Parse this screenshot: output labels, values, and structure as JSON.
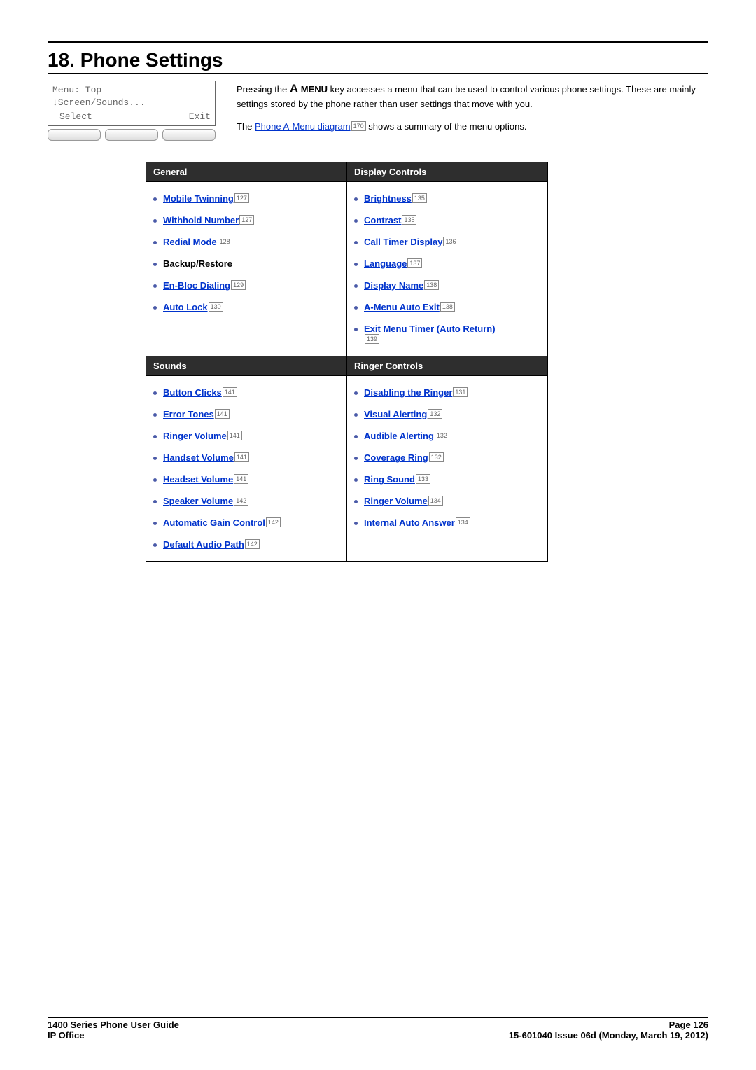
{
  "chapter": {
    "title": "18. Phone Settings"
  },
  "phone_screen": {
    "line1": "Menu: Top",
    "line2": "↓Screen/Sounds...",
    "softkey_left": "Select",
    "softkey_right": "Exit"
  },
  "intro": {
    "para1_pre": "Pressing the ",
    "menu_key": "MENU",
    "para1_post": " key accesses a menu that can be used to control various phone settings. These are mainly settings stored by the phone rather than user settings that move with you.",
    "para2_pre": "The ",
    "para2_link": "Phone A-Menu diagram",
    "para2_ref": "170",
    "para2_post": " shows a summary of the menu options."
  },
  "table": {
    "headers": {
      "general": "General",
      "display": "Display Controls",
      "sounds": "Sounds",
      "ringer": "Ringer Controls"
    },
    "general": [
      {
        "label": "Mobile Twinning",
        "ref": "127",
        "plain": false
      },
      {
        "label": "Withhold Number",
        "ref": "127",
        "plain": false
      },
      {
        "label": "Redial Mode",
        "ref": "128",
        "plain": false
      },
      {
        "label": "Backup/Restore",
        "plain": true
      },
      {
        "label": "En-Bloc Dialing",
        "ref": "129",
        "plain": false
      },
      {
        "label": "Auto Lock",
        "ref": "130",
        "plain": false
      }
    ],
    "display": [
      {
        "label": "Brightness",
        "ref": "135"
      },
      {
        "label": "Contrast",
        "ref": "135"
      },
      {
        "label": "Call Timer Display",
        "ref": "136"
      },
      {
        "label": "Language",
        "ref": "137"
      },
      {
        "label": "Display Name",
        "ref": "138"
      },
      {
        "label": "A-Menu Auto Exit",
        "ref": "138"
      },
      {
        "label": "Exit Menu Timer (Auto Return)",
        "ref": "139",
        "refbelow": true
      }
    ],
    "sounds": [
      {
        "label": "Button Clicks",
        "ref": "141"
      },
      {
        "label": "Error Tones",
        "ref": "141"
      },
      {
        "label": "Ringer Volume",
        "ref": "141"
      },
      {
        "label": "Handset Volume",
        "ref": "141"
      },
      {
        "label": "Headset Volume",
        "ref": "141"
      },
      {
        "label": "Speaker Volume",
        "ref": "142"
      },
      {
        "label": "Automatic Gain Control",
        "ref": "142"
      },
      {
        "label": "Default Audio Path",
        "ref": "142"
      }
    ],
    "ringer": [
      {
        "label": "Disabling the Ringer",
        "ref": "131"
      },
      {
        "label": "Visual Alerting",
        "ref": "132"
      },
      {
        "label": "Audible Alerting",
        "ref": "132"
      },
      {
        "label": "Coverage Ring",
        "ref": "132"
      },
      {
        "label": "Ring Sound",
        "ref": "133"
      },
      {
        "label": "Ringer Volume",
        "ref": "134"
      },
      {
        "label": "Internal Auto Answer",
        "ref": "134"
      }
    ]
  },
  "footer": {
    "left1": "1400 Series Phone User Guide",
    "left2": "IP Office",
    "right1": "Page 126",
    "right2": "15-601040 Issue 06d (Monday, March 19, 2012)"
  }
}
